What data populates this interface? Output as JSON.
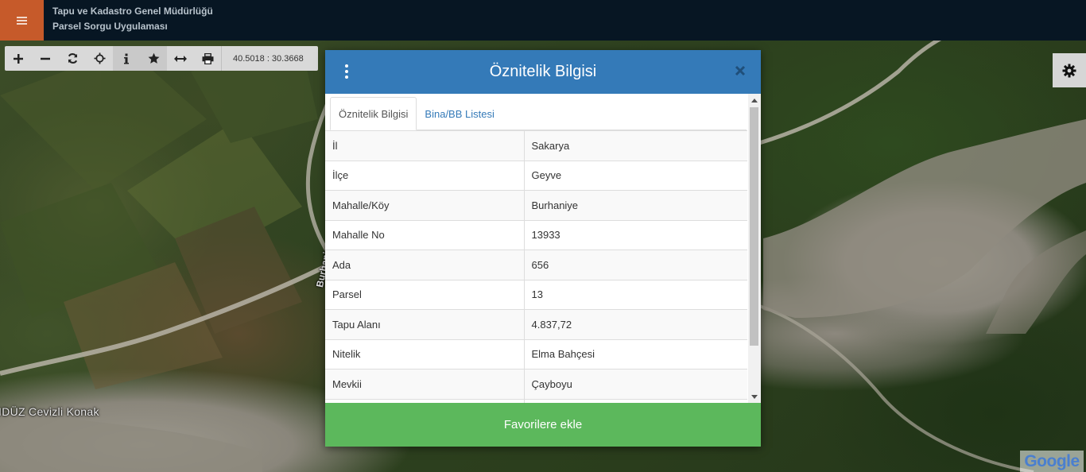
{
  "header": {
    "title_line1": "Tapu ve Kadastro Genel Müdürlüğü",
    "title_line2": "Parsel Sorgu Uygulaması"
  },
  "toolbar": {
    "tools": [
      "zoom-in-icon",
      "zoom-out-icon",
      "refresh-icon",
      "locate-icon",
      "info-icon",
      "star-icon",
      "measure-icon",
      "print-icon"
    ],
    "coordinates": "40.5018 : 30.3668"
  },
  "map": {
    "place_label": "IDÜZ Cevizli Konak",
    "road_label": "Burhaniye",
    "attribution": "Google"
  },
  "modal": {
    "title": "Öznitelik Bilgisi",
    "tabs": [
      {
        "label": "Öznitelik Bilgisi",
        "active": true
      },
      {
        "label": "Bina/BB Listesi",
        "active": false
      }
    ],
    "rows": [
      {
        "key": "İl",
        "value": "Sakarya"
      },
      {
        "key": "İlçe",
        "value": "Geyve"
      },
      {
        "key": "Mahalle/Köy",
        "value": "Burhaniye"
      },
      {
        "key": "Mahalle No",
        "value": "13933"
      },
      {
        "key": "Ada",
        "value": "656"
      },
      {
        "key": "Parsel",
        "value": "13"
      },
      {
        "key": "Tapu Alanı",
        "value": "4.837,72"
      },
      {
        "key": "Nitelik",
        "value": "Elma Bahçesi"
      },
      {
        "key": "Mevkii",
        "value": "Çayboyu"
      }
    ],
    "favorite_button": "Favorilere ekle"
  },
  "colors": {
    "header_bg": "#071623",
    "menu_accent": "#c65a2a",
    "modal_header": "#347ab8",
    "favorite_button": "#5cb85c"
  }
}
